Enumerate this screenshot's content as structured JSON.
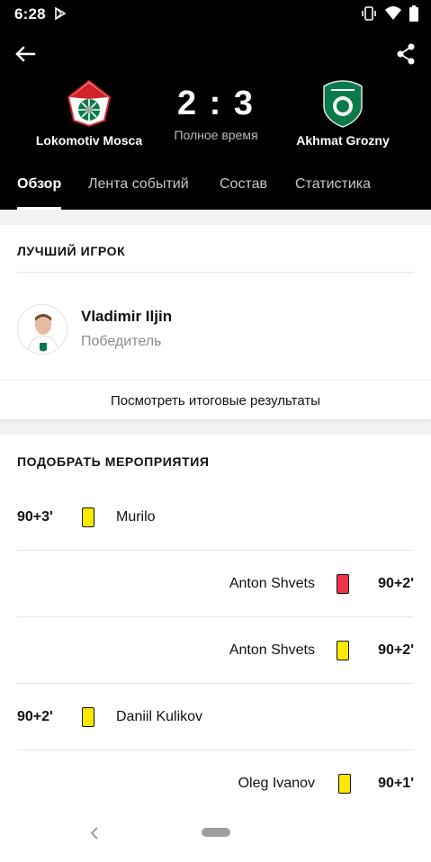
{
  "status": {
    "time": "6:28"
  },
  "match": {
    "home_team": "Lokomotiv Mosca",
    "away_team": "Akhmat Grozny",
    "home_score": "2",
    "away_score": "3",
    "separator": ":",
    "status": "Полное время"
  },
  "tabs": [
    {
      "label": "Обзор",
      "active": true
    },
    {
      "label": "Лента событий",
      "active": false
    },
    {
      "label": "Состав",
      "active": false
    },
    {
      "label": "Статистика",
      "active": false
    }
  ],
  "best_player": {
    "section_title": "ЛУЧШИЙ ИГРОК",
    "name": "Vladimir Iljin",
    "subtitle": "Победитель",
    "results_link": "Посмотреть итоговые результаты"
  },
  "events": {
    "section_title": "ПОДОБРАТЬ МЕРОПРИЯТИЯ",
    "items": [
      {
        "time": "90+3'",
        "player": "Murilo",
        "side": "home",
        "card": "yellow"
      },
      {
        "time": "90+2'",
        "player": "Anton Shvets",
        "side": "away",
        "card": "red"
      },
      {
        "time": "90+2'",
        "player": "Anton Shvets",
        "side": "away",
        "card": "yellow"
      },
      {
        "time": "90+2'",
        "player": "Daniil Kulikov",
        "side": "home",
        "card": "yellow"
      },
      {
        "time": "90+1'",
        "player": "Oleg Ivanov",
        "side": "away",
        "card": "yellow"
      }
    ]
  },
  "colors": {
    "header_bg": "#000000",
    "yellow_card": "#fde800",
    "red_card": "#f0324b",
    "home_red": "#d2232a",
    "away_green": "#0b7a4b"
  },
  "icons": {
    "back": "arrow-left-icon",
    "share": "share-icon",
    "play_store": "play-store-icon",
    "vibrate": "vibrate-icon",
    "wifi": "wifi-icon",
    "battery": "battery-icon"
  }
}
